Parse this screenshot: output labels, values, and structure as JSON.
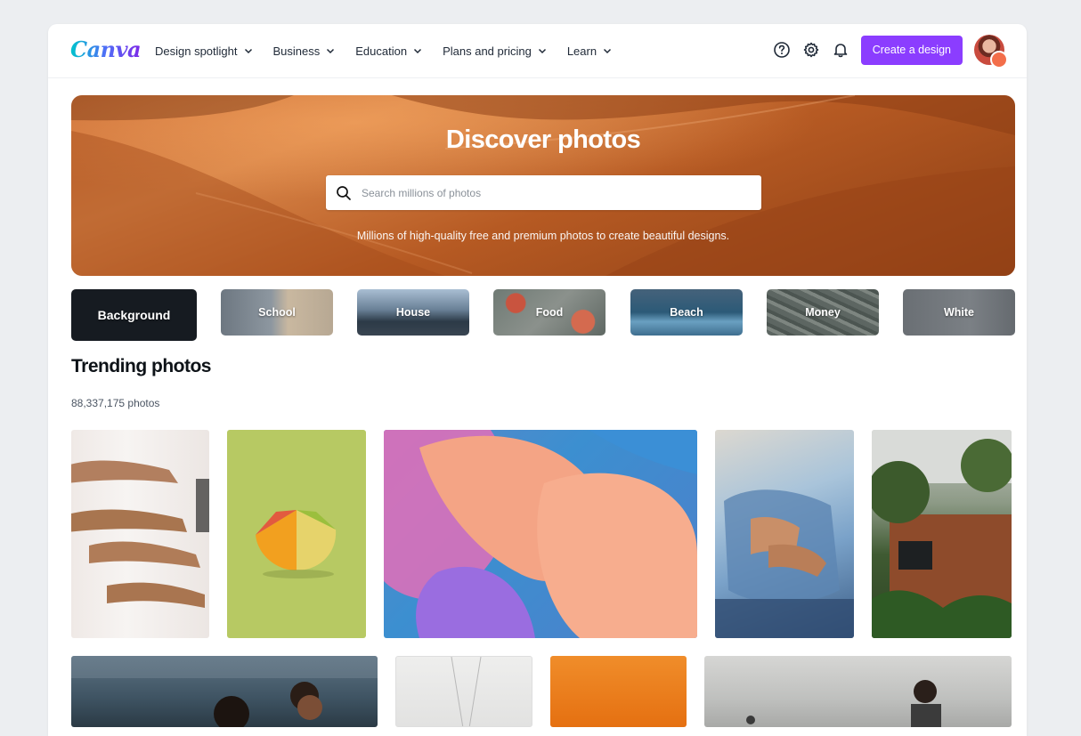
{
  "brand": {
    "logo_text": "Canva",
    "accent": "#8b3dff"
  },
  "nav": {
    "items": [
      {
        "label": "Design spotlight"
      },
      {
        "label": "Business"
      },
      {
        "label": "Education"
      },
      {
        "label": "Plans and pricing"
      },
      {
        "label": "Learn"
      }
    ],
    "icons": [
      "help-icon",
      "settings-icon",
      "notifications-icon"
    ],
    "cta_label": "Create a design"
  },
  "hero": {
    "title": "Discover photos",
    "search_placeholder": "Search millions of photos",
    "subtitle": "Millions of high-quality free and premium photos to create beautiful designs."
  },
  "categories": [
    {
      "label": "Background"
    },
    {
      "label": "School"
    },
    {
      "label": "House"
    },
    {
      "label": "Food"
    },
    {
      "label": "Beach"
    },
    {
      "label": "Money"
    },
    {
      "label": "White"
    }
  ],
  "trending": {
    "title": "Trending photos",
    "count_text": "88,337,175 photos"
  }
}
